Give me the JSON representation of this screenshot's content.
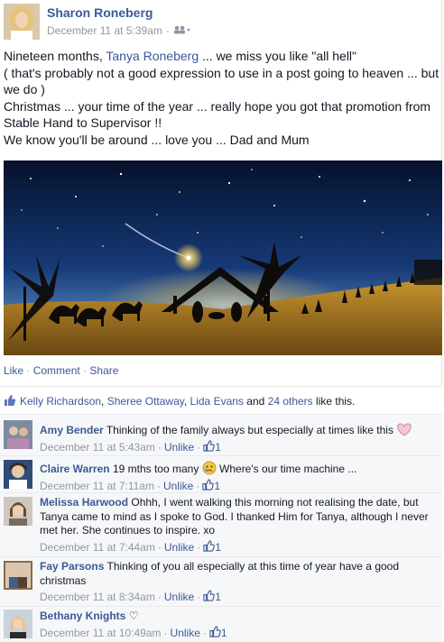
{
  "post": {
    "author": "Sharon Roneberg",
    "timestamp": "December 11 at 5:39am",
    "body": {
      "line1_pre": "Nineteen months, ",
      "line1_tag": "Tanya Roneberg",
      "line1_post": " ... we miss you like \"all hell\"",
      "line2": "( that's probably not a good expression to use in a post going to heaven ... but we do )",
      "line3": "Christmas ... your time of the year ... really hope you got that promotion from Stable Hand to Supervisor !!",
      "line4": "We know you'll be around ... love you ... Dad and Mum"
    },
    "actions": {
      "like": "Like",
      "comment": "Comment",
      "share": "Share",
      "sep": "·"
    },
    "likes": {
      "name1": "Kelly Richardson",
      "name2": "Sheree Ottaway",
      "name3": "Lida Evans",
      "conj": "and",
      "others": "24 others",
      "suffix": "like this."
    }
  },
  "comments": [
    {
      "name": "Amy Bender",
      "text": "Thinking of the family always but especially at times like this",
      "emoji": "heart-icon",
      "time": "December 11 at 5:43am",
      "unlike": "Unlike",
      "count": "1"
    },
    {
      "name": "Claire Warren",
      "text": "19 mths too many",
      "text_after": "Where's our time machine ...",
      "emoji": "crying-face-icon",
      "time": "December 11 at 7:11am",
      "unlike": "Unlike",
      "count": "1"
    },
    {
      "name": "Melissa Harwood",
      "text": "Ohhh, I went walking this morning not realising the date, but Tanya came to mind as I spoke to God. I thanked Him for Tanya, although I never met her. She continues to inspire. xo",
      "time": "December 11 at 7:44am",
      "unlike": "Unlike",
      "count": "1"
    },
    {
      "name": "Fay Parsons",
      "text": "Thinking of you all especially at this time of year have a good christmas",
      "time": "December 11 at 8:34am",
      "unlike": "Unlike",
      "count": "1"
    },
    {
      "name": "Bethany Knights",
      "text": "♡",
      "time": "December 11 at 10:49am",
      "unlike": "Unlike",
      "count": "1"
    }
  ],
  "colors": {
    "link": "#3b5998",
    "muted": "#9197a3",
    "comment_bg": "#f6f7f8"
  }
}
